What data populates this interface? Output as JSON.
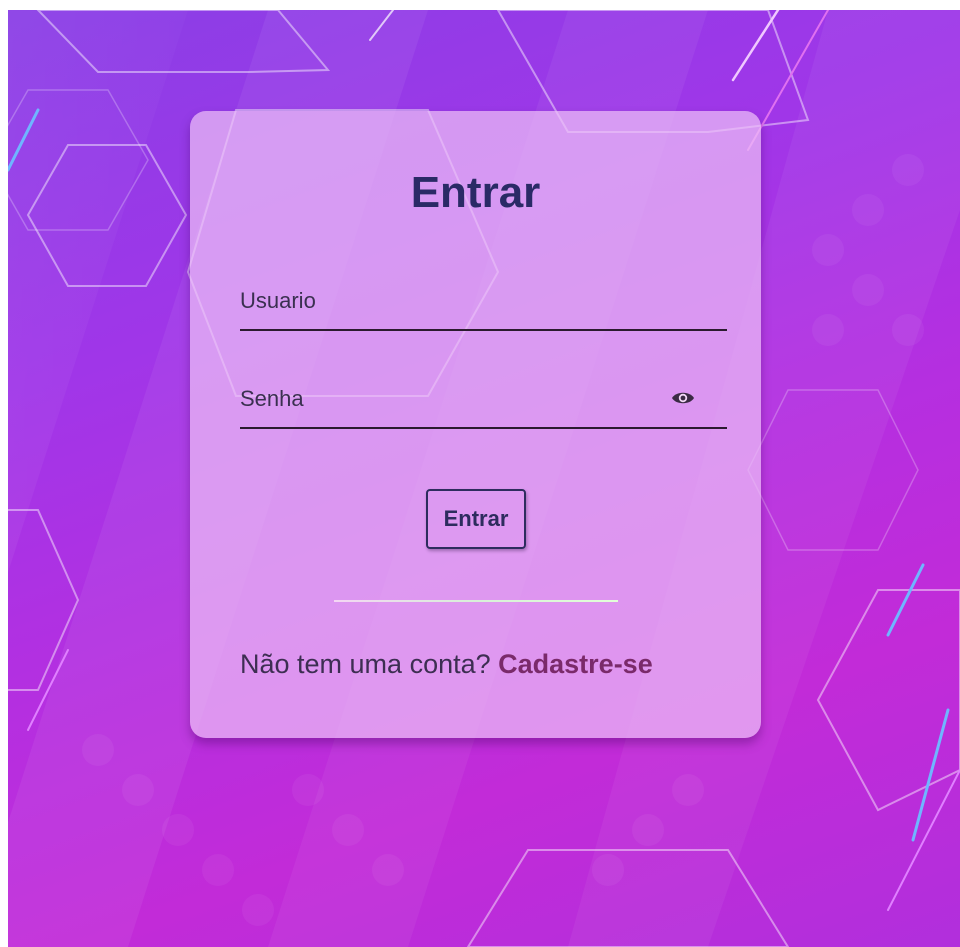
{
  "colors": {
    "background_start": "#8a3fe6",
    "background_end": "#c22bd8",
    "card": "#ecbef6",
    "title": "#2a2a66",
    "button_border": "#2d2c5e",
    "link": "#7a2a6a"
  },
  "login": {
    "title": "Entrar",
    "username_placeholder": "Usuario",
    "username_value": "",
    "password_placeholder": "Senha",
    "password_value": "",
    "show_password_icon": "eye-icon",
    "submit_label": "Entrar",
    "signup_prompt": "Não tem uma conta? ",
    "signup_link": "Cadastre-se"
  }
}
